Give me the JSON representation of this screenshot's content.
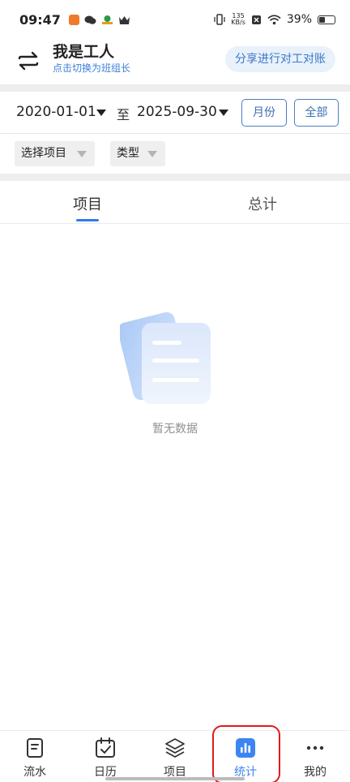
{
  "status_bar": {
    "time": "09:47",
    "net_speed_value": "135",
    "net_speed_unit": "KB/s",
    "battery": "39%",
    "battery_level": 0.39
  },
  "header": {
    "title": "我是工人",
    "subtitle": "点击切换为班组长",
    "share_button": "分享进行对工对账"
  },
  "date_filter": {
    "start_date": "2020-01-01",
    "to_label": "至",
    "end_date": "2025-09-30",
    "month_button": "月份",
    "all_button": "全部"
  },
  "filters": {
    "project": "选择项目",
    "type": "类型"
  },
  "tabs": {
    "items": [
      "项目",
      "总计"
    ],
    "active": "项目"
  },
  "empty_state": {
    "message": "暂无数据",
    "icon": "document-icon"
  },
  "bottom_nav": {
    "items": [
      {
        "label": "流水",
        "icon": "document-icon"
      },
      {
        "label": "日历",
        "icon": "calendar-icon"
      },
      {
        "label": "项目",
        "icon": "layers-icon"
      },
      {
        "label": "统计",
        "icon": "bar-chart-icon"
      },
      {
        "label": "我的",
        "icon": "more-icon"
      }
    ],
    "active": "统计"
  },
  "colors": {
    "accent": "#2f7bea",
    "highlight": "#e11a1a",
    "subtitle": "#3d7fd9"
  }
}
